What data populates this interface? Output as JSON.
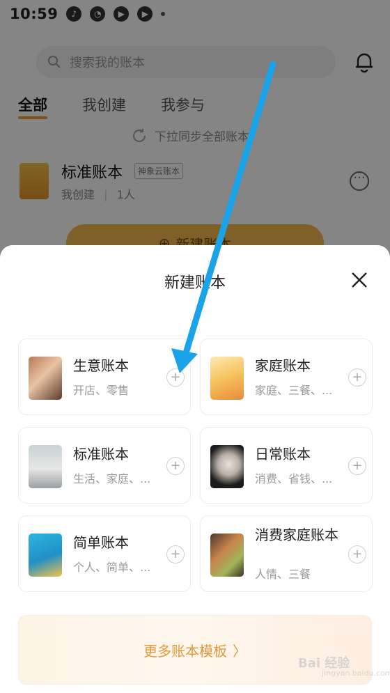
{
  "status_bar": {
    "time": "10:59"
  },
  "background_page": {
    "search_placeholder": "搜索我的账本",
    "tabs": [
      {
        "label": "全部",
        "active": true
      },
      {
        "label": "我创建",
        "active": false
      },
      {
        "label": "我参与",
        "active": false
      }
    ],
    "sync_hint": "下拉同步全部账本",
    "ledger": {
      "name": "标准账本",
      "tag": "神象云账本",
      "creator": "我创建",
      "members": "1人"
    },
    "new_ledger_button": "新建账本"
  },
  "sheet": {
    "title": "新建账本",
    "templates": [
      {
        "title": "生意账本",
        "subtitle": "开店、零售"
      },
      {
        "title": "家庭账本",
        "subtitle": "家庭、三餐、..."
      },
      {
        "title": "标准账本",
        "subtitle": "生活、家庭、..."
      },
      {
        "title": "日常账本",
        "subtitle": "消费、省钱、..."
      },
      {
        "title": "简单账本",
        "subtitle": "个人、简单、..."
      },
      {
        "title": "消费家庭账本",
        "subtitle": "人情、三餐"
      }
    ],
    "more_templates": "更多账本模板"
  },
  "colors": {
    "accent": "#f0a030",
    "arrow": "#1aa3e8",
    "more_text": "#e39a3a"
  }
}
